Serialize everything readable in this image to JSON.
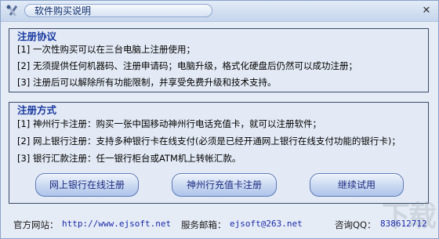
{
  "window": {
    "title": "软件购买说明",
    "close_glyph": "✕"
  },
  "agreement": {
    "title": "注册协议",
    "lines": [
      "[1] 一次性购买可以在三台电脑上注册使用；",
      "[2] 无须提供任何机器码、注册申请码；电脑升级，格式化硬盘后仍然可以成功注册；",
      "[3] 注册后可以解除所有功能限制，并享受免费升级和技术支持。"
    ]
  },
  "methods": {
    "title": "注册方式",
    "lines": [
      "[1] 神州行卡注册：购买一张中国移动神州行电话充值卡，就可以注册软件；",
      "[2] 网上银行注册：支持多种银行卡在线支付(必须是已经开通网上银行在线支付功能的银行卡)；",
      "[3] 银行汇款注册：任一银行柜台或ATM机上转帐汇款。"
    ]
  },
  "buttons": {
    "online_bank": "网上银行在线注册",
    "shenzhouxing": "神州行充值卡注册",
    "continue_trial": "继续试用"
  },
  "footer": {
    "website_label": "官方网站：",
    "website_value": "http://www.ejsoft.net",
    "email_label": "服务邮箱：",
    "email_value": "ejsoft@263.net",
    "qq_label": "咨询QQ：",
    "qq_value": "838612712"
  },
  "colors": {
    "accent": "#1a3aa0",
    "frame": "#3a4a6a"
  }
}
